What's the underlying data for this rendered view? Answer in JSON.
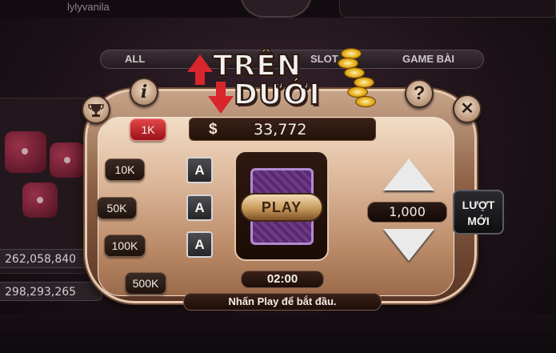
{
  "background": {
    "username": "lylyvanila",
    "tabs": [
      "ALL",
      "SLOT",
      "GAME BÀI"
    ],
    "values": [
      "262,058,840",
      "298,293,265"
    ]
  },
  "game": {
    "title_line1": "TRÊN",
    "title_line2": "DƯỚI",
    "balance_icon": "$",
    "balance": "33,772",
    "buttons": {
      "info": "i",
      "help": "?",
      "close": "✕",
      "trophy_icon": "trophy-icon"
    },
    "chips": [
      "1K",
      "10K",
      "50K",
      "100K",
      "500K"
    ],
    "active_chip": "1K",
    "card_slots": [
      "A",
      "A",
      "A"
    ],
    "play_label": "PLAY",
    "timer": "02:00",
    "bet_amount": "1,000",
    "new_round_line1": "LƯỢT",
    "new_round_line2": "MỚI",
    "status": "Nhấn Play để bắt đầu."
  },
  "colors": {
    "accent_red": "#d8262c",
    "frame": "#8d6146",
    "card_back": "#6e3a88"
  }
}
